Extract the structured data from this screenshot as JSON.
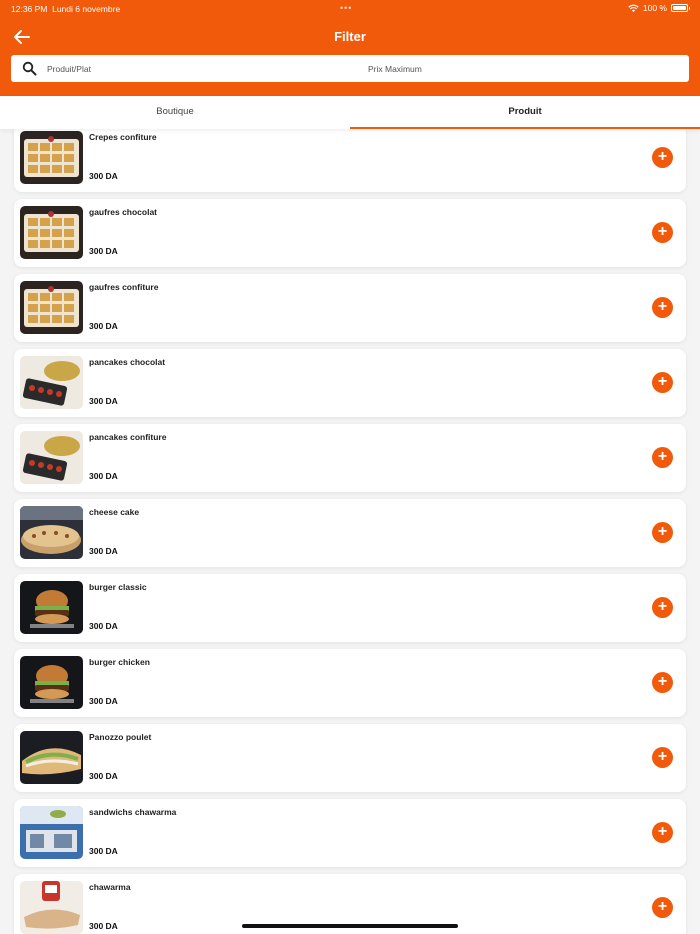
{
  "status_bar": {
    "time": "12:36 PM",
    "date": "Lundi 6 novembre",
    "more": "•••",
    "battery": "100 %",
    "battery_level": 1.0
  },
  "header": {
    "title": "Filter",
    "back_icon": "arrow-left-icon"
  },
  "search": {
    "product_placeholder": "Produit/Plat",
    "price_placeholder": "Prix Maximum",
    "product_value": "",
    "price_value": ""
  },
  "tabs": [
    {
      "label": "Boutique",
      "active": false
    },
    {
      "label": "Produit",
      "active": true
    }
  ],
  "items": [
    {
      "name": "Crepes confiture",
      "price": "300 DA",
      "image": "waffles"
    },
    {
      "name": "gaufres chocolat",
      "price": "300 DA",
      "image": "waffles"
    },
    {
      "name": "gaufres confiture",
      "price": "300 DA",
      "image": "waffles"
    },
    {
      "name": "pancakes chocolat",
      "price": "300 DA",
      "image": "pancakes"
    },
    {
      "name": "pancakes confiture",
      "price": "300 DA",
      "image": "pancakes"
    },
    {
      "name": "cheese cake",
      "price": "300 DA",
      "image": "cake"
    },
    {
      "name": "burger classic",
      "price": "300 DA",
      "image": "burger"
    },
    {
      "name": "burger chicken",
      "price": "300 DA",
      "image": "burger"
    },
    {
      "name": "Panozzo poulet",
      "price": "300 DA",
      "image": "sandwich"
    },
    {
      "name": "sandwichs chawarma",
      "price": "300 DA",
      "image": "shop"
    },
    {
      "name": "chawarma",
      "price": "300 DA",
      "image": "wrap"
    }
  ],
  "colors": {
    "accent": "#f05a0a",
    "background": "#f4f4f4"
  }
}
